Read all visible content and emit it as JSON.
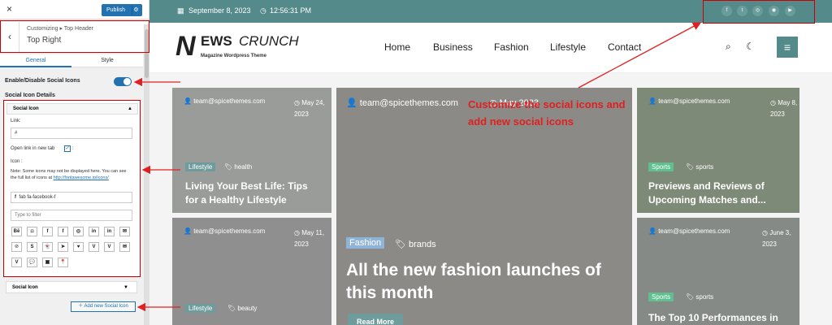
{
  "customizer": {
    "close_icon": "×",
    "publish_label": "Publish",
    "breadcrumb": "Customizing ▸ Top Header",
    "section_title": "Top Right",
    "tabs": [
      "General",
      "Style"
    ],
    "enable_label": "Enable/Disable Social Icons",
    "details_label": "Social Icon Details",
    "social_icon_header": "Social Icon",
    "link_label": "Link:",
    "link_value": "#",
    "new_tab_label": "Open link in new tab",
    "icon_label": "Icon :",
    "note": "Note: Some icons may not be displayed here. You can see the full list of icons at",
    "note_link": "http://fontawesome.io/icons/",
    "icon_value": "fab fa-facebook-f",
    "filter_placeholder": "Type to filter",
    "icon_grid": [
      "Bē",
      "◘",
      "f",
      "f",
      "◎",
      "in",
      "in",
      "✉",
      "℗",
      "S",
      "👻",
      "➤",
      "♥",
      "V",
      "V",
      "✉",
      "V",
      "💬",
      "▣",
      "📍"
    ],
    "social_icon_header_2": "Social Icon",
    "add_button": "Add new Social Icon"
  },
  "topbar": {
    "date": "September 8, 2023",
    "time": "12:56:31 PM",
    "social": [
      "f",
      "t",
      "◎",
      "◉",
      "▶"
    ]
  },
  "header": {
    "logo_n": "N",
    "logo_main": "EWS",
    "logo_crunch": "CRUNCH",
    "tagline": "Magazine Wordpress Theme",
    "nav": [
      "Home",
      "Business",
      "Fashion",
      "Lifestyle",
      "Contact"
    ]
  },
  "cards": [
    {
      "author": "team@spicethemes.com",
      "date": "May 24, 2023",
      "cat": "Lifestyle",
      "tag": "health",
      "title1": "Living Your Best Life: Tips",
      "title2": "for a Healthy Lifestyle"
    },
    {
      "author": "team@spicethemes.com",
      "date": "May 11, 2023",
      "cat": "Lifestyle",
      "tag": "beauty"
    },
    {
      "author": "team@spicethemes.com",
      "date": "May 2023",
      "cat": "Fashion",
      "tag": "brands",
      "title1": "All the new fashion launches of",
      "title2": "this month",
      "read_more": "Read More"
    },
    {
      "author": "team@spicethemes.com",
      "date": "May 8, 2023",
      "cat": "Sports",
      "tag": "sports",
      "title1": "Previews and Reviews of",
      "title2": "Upcoming Matches and..."
    },
    {
      "author": "team@spicethemes.com",
      "date": "June 3, 2023",
      "cat": "Sports",
      "tag": "sports",
      "title1": "The Top 10 Performances in"
    }
  ],
  "annotation": {
    "line1": "Customize the social icons and",
    "line2": "add new social icons"
  },
  "colors": {
    "accent": "#558a8a",
    "wp_blue": "#2271b1",
    "annotation_red": "#e02020"
  }
}
